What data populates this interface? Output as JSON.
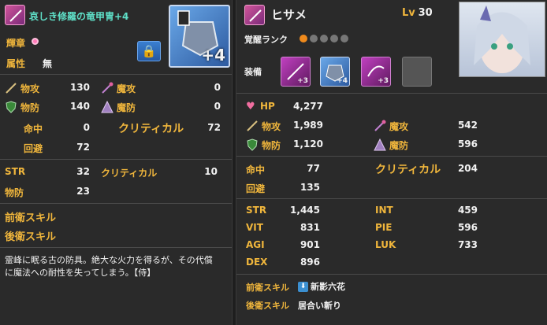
{
  "equipment": {
    "name": "哀しき修羅の竜甲冑+4",
    "glory_label": "輝章",
    "attribute_label": "属性",
    "attribute_value": "無",
    "plus_label": "+4",
    "stats": {
      "patk_label": "物攻",
      "patk": "130",
      "matk_label": "魔攻",
      "matk": "0",
      "pdef_label": "物防",
      "pdef": "140",
      "mdef_label": "魔防",
      "mdef": "0",
      "hit_label": "命中",
      "hit": "0",
      "crit_label": "クリティカル",
      "crit": "72",
      "evade_label": "回避",
      "evade": "72"
    },
    "bonus": {
      "str_label": "STR",
      "str": "32",
      "crit_label": "クリティカル",
      "crit": "10",
      "pdef_label": "物防",
      "pdef": "23"
    },
    "front_skill_label": "前衛スキル",
    "back_skill_label": "後衛スキル",
    "description_line1": "霊峰に眠る古の防具。絶大な火力を得るが、その代償",
    "description_line2": "に魔法への耐性を失ってしまう。【侍】"
  },
  "character": {
    "name": "ヒサメ",
    "lv_label": "Lv",
    "lv_value": "30",
    "awaken_label": "覚醒ランク",
    "awaken_filled": 1,
    "awaken_total": 5,
    "equip_label": "装備",
    "slot1_plus": "+3",
    "slot2_plus": "+4",
    "slot3_plus": "+3",
    "stats": {
      "hp_label": "HP",
      "hp": "4,277",
      "patk_label": "物攻",
      "patk": "1,989",
      "matk_label": "魔攻",
      "matk": "542",
      "pdef_label": "物防",
      "pdef": "1,120",
      "mdef_label": "魔防",
      "mdef": "596",
      "hit_label": "命中",
      "hit": "77",
      "crit_label": "クリティカル",
      "crit": "204",
      "evade_label": "回避",
      "evade": "135"
    },
    "attrs": {
      "str_label": "STR",
      "str": "1,445",
      "int_label": "INT",
      "int": "459",
      "vit_label": "VIT",
      "vit": "831",
      "pie_label": "PIE",
      "pie": "596",
      "agi_label": "AGI",
      "agi": "901",
      "luk_label": "LUK",
      "luk": "733",
      "dex_label": "DEX",
      "dex": "896"
    },
    "front_skill_label": "前衛スキル",
    "front_skill_value": "新影六花",
    "back_skill_label": "後衛スキル",
    "back_skill_value": "居合い斬り"
  },
  "colors": {
    "accent_orange": "#f0b63c",
    "teal": "#5fe0c8",
    "bg": "#2a2a2a"
  },
  "icons": [
    "sword-icon",
    "shield-icon",
    "staff-icon",
    "lock-icon",
    "heart-icon",
    "armor-icon",
    "portrait"
  ]
}
